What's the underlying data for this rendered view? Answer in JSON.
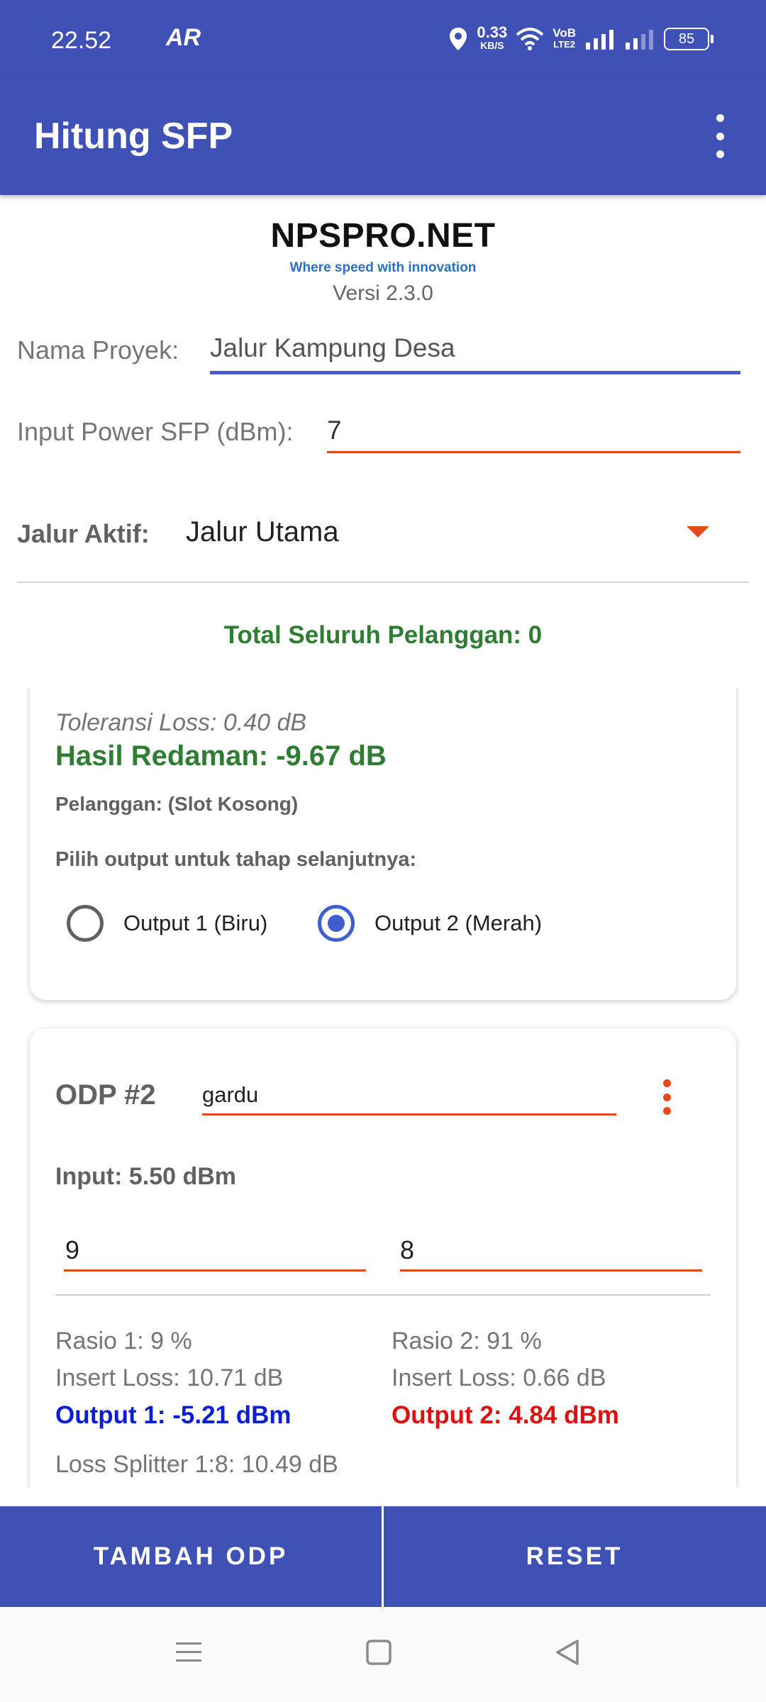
{
  "status_bar": {
    "time": "22.52",
    "ar_icon": "AR",
    "speed_value": "0.33",
    "speed_unit": "KB/S",
    "volte_top": "VoB",
    "volte_bottom": "LTE2",
    "battery": "85",
    "icons": [
      "location-icon",
      "wifi-icon",
      "signal-icon",
      "signal-icon-2",
      "battery-icon"
    ]
  },
  "app_bar": {
    "title": "Hitung SFP",
    "menu_icon": "more-vert-icon"
  },
  "header": {
    "brand": "NPSPRO.NET",
    "tagline": "Where speed with innovation",
    "version": "Versi 2.3.0"
  },
  "form": {
    "project_label": "Nama Proyek:",
    "project_value": "Jalur Kampung Desa",
    "power_label": "Input Power SFP (dBm):",
    "power_value": "7",
    "path_label": "Jalur Aktif:",
    "path_value": "Jalur Utama"
  },
  "total_customers": "Total Seluruh Pelanggan: 0",
  "odp1": {
    "tolerance": "Toleransi Loss: 0.40 dB",
    "result": "Hasil Redaman: -9.67 dB",
    "customer": "Pelanggan: (Slot Kosong)",
    "choose_output": "Pilih output untuk tahap selanjutnya:",
    "option1": "Output 1 (Biru)",
    "option2": "Output 2 (Merah)",
    "selected_option": "Output 2 (Merah)"
  },
  "odp2": {
    "title": "ODP #2",
    "name_value": "gardu",
    "input": "Input: 5.50 dBm",
    "value1": "9",
    "value2": "8",
    "ratio1": "Rasio 1: 9 %",
    "insert_loss1": "Insert Loss: 10.71 dB",
    "output1": "Output 1: -5.21 dBm",
    "ratio2": "Rasio 2: 91 %",
    "insert_loss2": "Insert Loss: 0.66 dB",
    "output2": "Output 2: 4.84 dBm",
    "splitter_loss": "Loss Splitter 1:8: 10.49 dB"
  },
  "buttons": {
    "add": "TAMBAH ODP",
    "reset": "RESET"
  },
  "nav_bar": {
    "icons": [
      "menu-icon",
      "home-square-icon",
      "back-triangle-icon"
    ]
  },
  "colors": {
    "primary": "#3f51b5",
    "accent": "#e64a19",
    "success": "#2e7d32",
    "output1": "#0d1fd6",
    "output2": "#e01010",
    "radio": "#3f5fd0"
  }
}
